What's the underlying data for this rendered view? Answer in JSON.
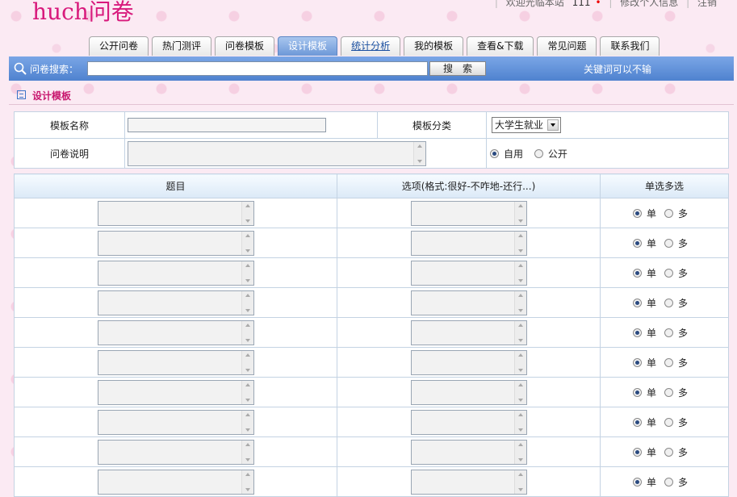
{
  "header": {
    "logo": "huch问卷",
    "welcome": "欢迎光临本站",
    "username": "111",
    "edit_profile": "修改个人信息",
    "logout": "注销"
  },
  "tabs": [
    {
      "label": "公开问卷"
    },
    {
      "label": "热门测评"
    },
    {
      "label": "问卷模板"
    },
    {
      "label": "设计模板"
    },
    {
      "label": "统计分析"
    },
    {
      "label": "我的模板"
    },
    {
      "label": "查看&下载"
    },
    {
      "label": "常见问题"
    },
    {
      "label": "联系我们"
    }
  ],
  "search": {
    "label": "问卷搜索：",
    "value": "",
    "button": "搜索",
    "hint": "关键词可以不输"
  },
  "section_title": "设计模板",
  "form": {
    "name_label": "模板名称",
    "name_value": "",
    "category_label": "模板分类",
    "category_value": "大学生就业",
    "desc_label": "问卷说明",
    "desc_value": "",
    "visibility_options": [
      "自用",
      "公开"
    ],
    "visibility_selected": "自用"
  },
  "questions": {
    "headers": [
      "题目",
      "选项(格式:很好-不咋地-还行...)",
      "单选多选"
    ],
    "type_options": [
      "单",
      "多"
    ],
    "rows": [
      {
        "selected": "单"
      },
      {
        "selected": "单"
      },
      {
        "selected": "单"
      },
      {
        "selected": "单"
      },
      {
        "selected": "单"
      },
      {
        "selected": "单"
      },
      {
        "selected": "单"
      },
      {
        "selected": "单"
      },
      {
        "selected": "单"
      },
      {
        "selected": "单"
      }
    ]
  },
  "colors": {
    "brand": "#d81a7c",
    "searchbar": "#5b8ed6",
    "active_tab": "#7aa2dc"
  }
}
